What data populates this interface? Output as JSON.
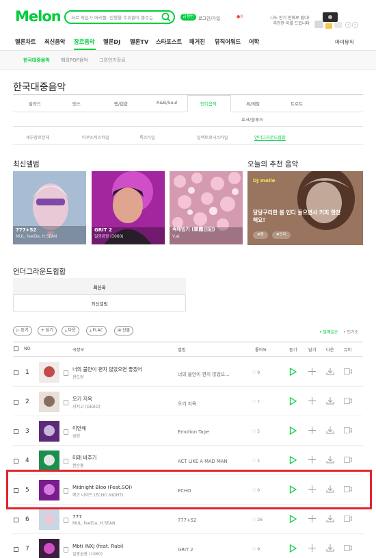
{
  "header": {
    "logo": "Melon",
    "search_placeholder": "서로 작은가 버리를, 인형을 주워들어 클주는",
    "badge": "급행번",
    "link": "로그인/가입",
    "notification": "●0",
    "promo_line1": "나도 인기 만화로 쉽다!",
    "promo_line2": "추천한 이를 드립니다",
    "prev": "‹",
    "next": "›"
  },
  "gnb": {
    "items": [
      "멜론차트",
      "최신음악",
      "장르음악",
      "멜론DJ",
      "멜론TV",
      "스타포스트",
      "매거진",
      "뮤직어워드",
      "어학"
    ],
    "right": "마이뮤직"
  },
  "subnav": {
    "items": [
      "한국대중음악",
      "해외POP음악",
      "그외인기장르"
    ]
  },
  "page_title": "한국대중음악",
  "genres": {
    "row1": [
      "발라드",
      "댄스",
      "랩/힙합",
      "R&B/Soul",
      "인디음악",
      "록/메탈",
      "트로트"
    ],
    "row2": [
      "포크/블루스"
    ],
    "styles": [
      "세부장르전체",
      "어쿠스틱스타일",
      "록스타일",
      "일렉트로닉스타일",
      "언더그라운드힙합"
    ]
  },
  "latest": {
    "title": "최신앨범",
    "albums": [
      {
        "title": "777+52",
        "artist": "MUL, feelDa, H.SEAN"
      },
      {
        "title": "GRIT 2",
        "artist": "일광곰광 (1060)"
      },
      {
        "title": "속에잎기 (翠霞日記)",
        "artist": "V.at"
      }
    ]
  },
  "recommend": {
    "title": "오늘의 추천 음악",
    "dj_label": "DJ melle",
    "headline": "달달구리한 봄 인디 들으면서 커피 한잔해요!",
    "tags": [
      "#봄",
      "#인디"
    ]
  },
  "tabs": {
    "section": "언더그라운드힙합",
    "songs": "최신곡",
    "albums": "최신앨범"
  },
  "toolbar": {
    "pills": [
      "▷ 듣기",
      "+ 담기",
      "⤓ 다운",
      "⤓ FLAC",
      "⊞ 선물"
    ],
    "sort_active": "• 발매일순",
    "sort_other": "• 인기순"
  },
  "table": {
    "headers": {
      "no": "NO",
      "song": "곡정보",
      "album": "앨범",
      "like": "좋아요",
      "play": "듣기",
      "add": "담기",
      "download": "다운",
      "mv": "뮤비"
    },
    "rows": [
      {
        "rank": "1",
        "title": "너의 불안이 편지 않았으면 좋겠어",
        "artist": "권도원",
        "album": "너의 불안이 편지 않았으...",
        "likes": "♡ 9"
      },
      {
        "rank": "2",
        "title": "오기 지옥",
        "artist": "지저고 (GIGIO)",
        "album": "오기 지옥",
        "likes": "♡ 7"
      },
      {
        "rank": "3",
        "title": "미안해",
        "artist": "성현",
        "album": "Emotion Tape",
        "likes": "♡ 5"
      },
      {
        "rank": "4",
        "title": "미래 바주기",
        "artist": "권순홍",
        "album": "ACT LIKE A MAD MAN",
        "likes": "♡ 2"
      },
      {
        "rank": "5",
        "title": "Midnight Bloo (Feat.SOI)",
        "artist": "에코 나이트 (ECHO NIGHT)",
        "album": "ECHO",
        "likes": "♡ 0"
      },
      {
        "rank": "6",
        "title": "777",
        "artist": "MUL, feelDa, H.SEAN",
        "album": "777+52",
        "likes": "♡ 26"
      },
      {
        "rank": "7",
        "title": "Mbti INXJ (feat. Rabi)",
        "artist": "일광곰광 (1060)",
        "album": "GRIT 2",
        "likes": "♡ 9"
      }
    ]
  },
  "colors": {
    "accent": "#00cd3c",
    "highlight": "#e3222b"
  }
}
